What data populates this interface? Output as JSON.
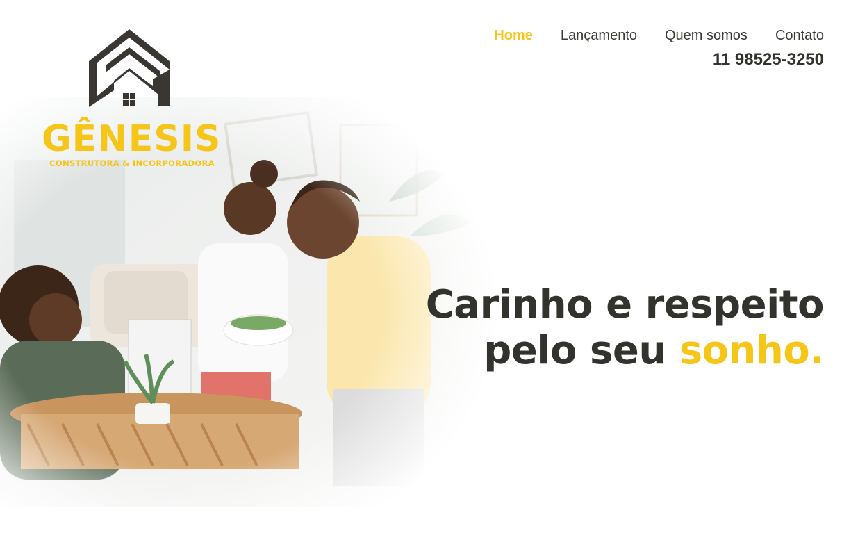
{
  "brand": {
    "name": "GÊNESIS",
    "tagline": "CONSTRUTORA & INCORPORADORA",
    "primary_color": "#f5c518",
    "dark_color": "#33332e"
  },
  "nav": {
    "items": [
      {
        "label": "Home",
        "active": true
      },
      {
        "label": "Lançamento",
        "active": false
      },
      {
        "label": "Quem somos",
        "active": false
      },
      {
        "label": "Contato",
        "active": false
      }
    ],
    "phone": "11 98525-3250"
  },
  "hero": {
    "headline_line1": "Carinho e respeito",
    "headline_line2_prefix": "pelo seu",
    "headline_line2_accent": "sonho."
  }
}
